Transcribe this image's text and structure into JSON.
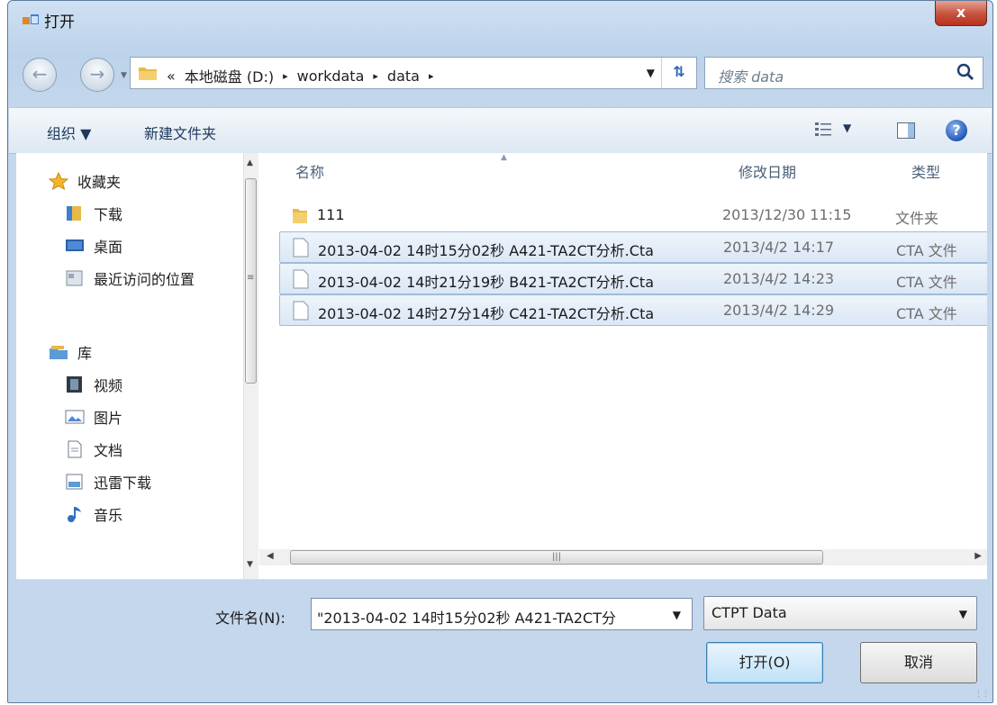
{
  "window": {
    "title": "打开",
    "close_label": "x"
  },
  "address": {
    "crumbs": [
      "«",
      "本地磁盘 (D:)",
      "▸",
      "workdata",
      "▸",
      "data",
      "▸"
    ],
    "search_placeholder": "搜索 data"
  },
  "toolbar": {
    "organize": "组织 ▼",
    "new_folder": "新建文件夹"
  },
  "nav": {
    "items": [
      {
        "label": "收藏夹",
        "icon": "star-icon"
      },
      {
        "label": "下载",
        "icon": "downloads-folder-icon"
      },
      {
        "label": "桌面",
        "icon": "desktop-icon"
      },
      {
        "label": "最近访问的位置",
        "icon": "recent-places-icon"
      },
      {
        "label": "库",
        "icon": "library-icon"
      },
      {
        "label": "视频",
        "icon": "video-icon"
      },
      {
        "label": "图片",
        "icon": "pictures-icon"
      },
      {
        "label": "文档",
        "icon": "documents-icon"
      },
      {
        "label": "迅雷下载",
        "icon": "thunder-download-icon"
      },
      {
        "label": "音乐",
        "icon": "music-icon"
      }
    ]
  },
  "columns": {
    "name": "名称",
    "date": "修改日期",
    "type": "类型"
  },
  "files": [
    {
      "name": "111",
      "date": "2013/12/30 11:15",
      "type": "文件夹",
      "icon": "folder-icon",
      "selected": false
    },
    {
      "name": "2013-04-02 14时15分02秒 A421-TA2CT分析.Cta",
      "date": "2013/4/2 14:17",
      "type": "CTA 文件",
      "icon": "file-icon",
      "selected": true
    },
    {
      "name": "2013-04-02 14时21分19秒 B421-TA2CT分析.Cta",
      "date": "2013/4/2 14:23",
      "type": "CTA 文件",
      "icon": "file-icon",
      "selected": true
    },
    {
      "name": "2013-04-02 14时27分14秒 C421-TA2CT分析.Cta",
      "date": "2013/4/2 14:29",
      "type": "CTA 文件",
      "icon": "file-icon",
      "selected": true
    }
  ],
  "bottom": {
    "filename_label": "文件名(N):",
    "filename_value": "\"2013-04-02 14时15分02秒 A421-TA2CT分",
    "filetype_value": "CTPT Data",
    "open_button": "打开(O)",
    "cancel_button": "取消"
  },
  "colors": {
    "selection": "#dbe7f6",
    "accent": "#3c7fb1",
    "close": "#c6513c"
  }
}
